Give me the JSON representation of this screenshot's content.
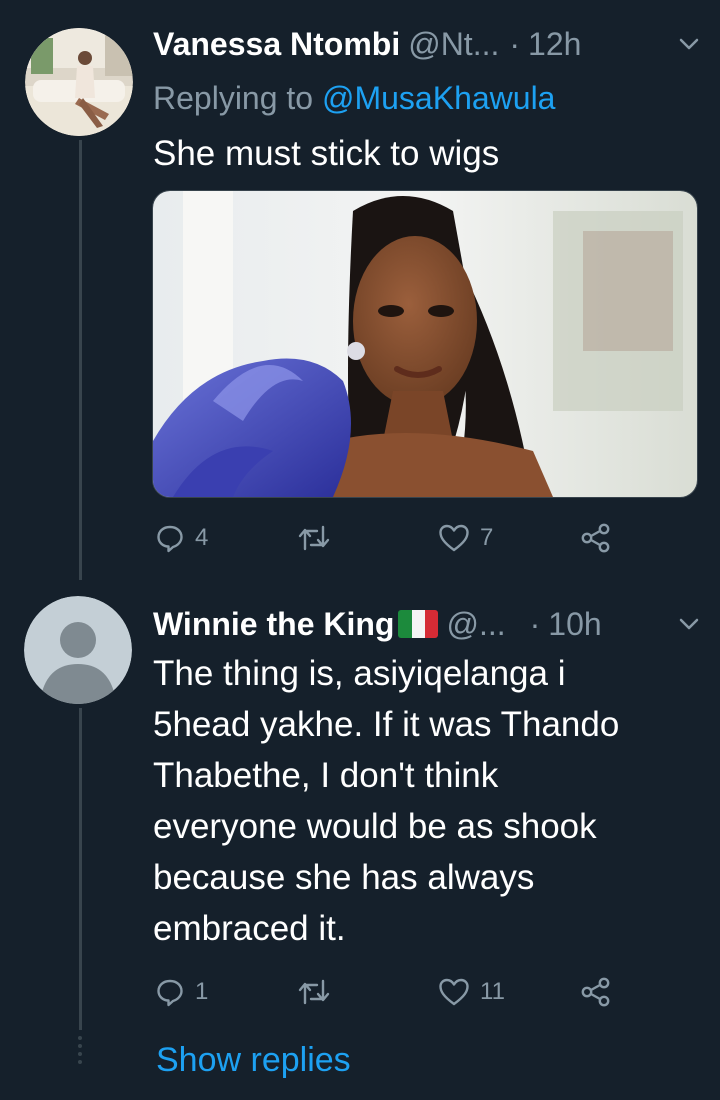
{
  "tweets": [
    {
      "name": "Vanessa Ntombi",
      "handle": "@Nt...",
      "time": "12h",
      "replying_prefix": "Replying to",
      "replying_to": "@MusaKhawula",
      "text": "She must stick to wigs",
      "replies": "4",
      "retweets": "",
      "likes": "7"
    },
    {
      "name": "Winnie the King",
      "handle": "@...",
      "time": "10h",
      "text_lines": [
        "The thing is, asiyiqelanga i",
        "5head yakhe. If it was Thando",
        "Thabethe, I don't think",
        "everyone would be as shook",
        "because she has always",
        "embraced it."
      ],
      "replies": "1",
      "retweets": "",
      "likes": "11"
    }
  ],
  "show_replies": "Show replies",
  "colors": {
    "background": "#15202b",
    "secondary_text": "#8899a6",
    "link": "#1da1f2",
    "divider": "#38444d"
  },
  "icons": {
    "reply": "reply-icon",
    "retweet": "retweet-icon",
    "like": "heart-icon",
    "share": "share-icon",
    "menu": "chevron-down-icon",
    "flag": "italy-flag-icon"
  }
}
